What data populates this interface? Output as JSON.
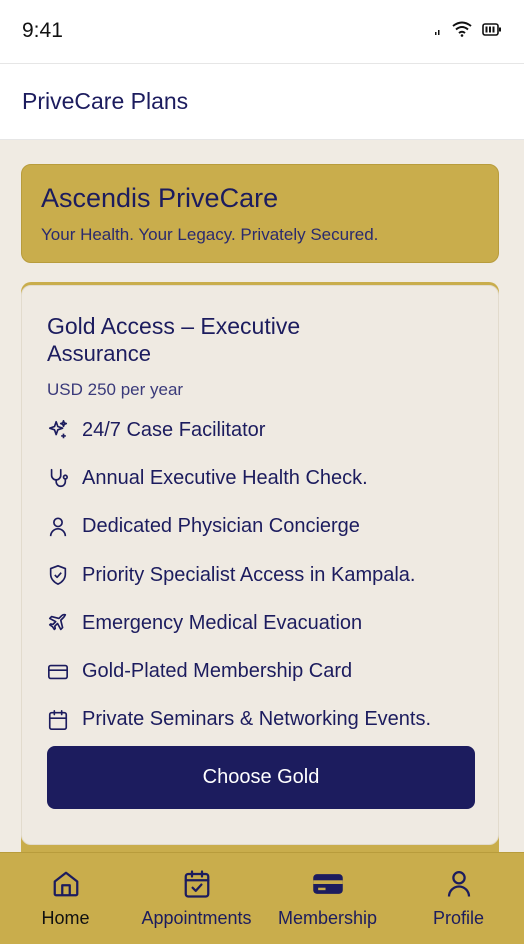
{
  "status_bar": {
    "time": "9:41"
  },
  "header": {
    "title": "PriveCare Plans"
  },
  "hero": {
    "title": "Ascendis PriveCare",
    "subtitle": "Your Health. Your Legacy. Privately Secured."
  },
  "plan": {
    "name_line1": "Gold Access – Executive",
    "name_line2": "Assurance",
    "price": "USD 250 per year",
    "features": [
      {
        "icon": "sparkle-icon",
        "label": "24/7 Case Facilitator"
      },
      {
        "icon": "stethoscope-icon",
        "label": "Annual Executive Health Check."
      },
      {
        "icon": "user-icon",
        "label": "Dedicated Physician Concierge"
      },
      {
        "icon": "shield-check-icon",
        "label": "Priority Specialist Access in Kampala."
      },
      {
        "icon": "plane-icon",
        "label": "Emergency Medical Evacuation"
      },
      {
        "icon": "credit-card-icon",
        "label": "Gold-Plated Membership Card"
      },
      {
        "icon": "calendar-icon",
        "label": "Private Seminars & Networking Events."
      }
    ],
    "cta_label": "Choose Gold"
  },
  "bottom_nav": {
    "items": [
      {
        "icon": "home-icon",
        "label": "Home",
        "active": true
      },
      {
        "icon": "calendar-check-icon",
        "label": "Appointments",
        "active": false
      },
      {
        "icon": "card-icon",
        "label": "Membership",
        "active": false
      },
      {
        "icon": "user-icon",
        "label": "Profile",
        "active": false
      }
    ]
  },
  "colors": {
    "brand_gold": "#c9ad4c",
    "navy": "#1c1c5e",
    "cream": "#efeae2"
  }
}
